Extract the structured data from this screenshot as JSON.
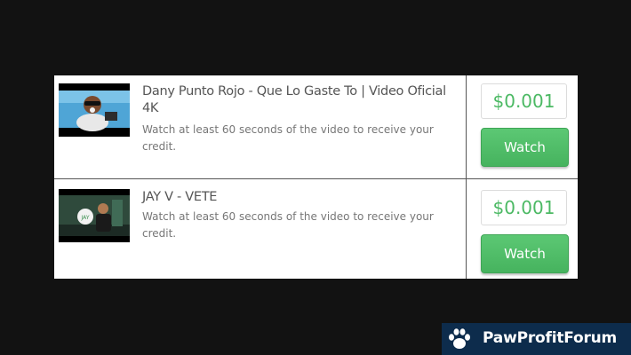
{
  "videos": [
    {
      "title": "Dany Punto Rojo - Que Lo Gaste To | Video Oficial 4K",
      "description": "Watch at least 60 seconds of the video to receive your credit.",
      "price": "$0.001",
      "button_label": "Watch"
    },
    {
      "title": "JAY V - VETE",
      "description": "Watch at least 60 seconds of the video to receive your credit.",
      "price": "$0.001",
      "button_label": "Watch"
    }
  ],
  "watermark": {
    "text": "PawProfitForum",
    "icon": "paw-icon"
  },
  "colors": {
    "accent": "#4cb964",
    "button": "#4cba63",
    "background": "#121212",
    "brand_bg": "#0d2c4c"
  }
}
